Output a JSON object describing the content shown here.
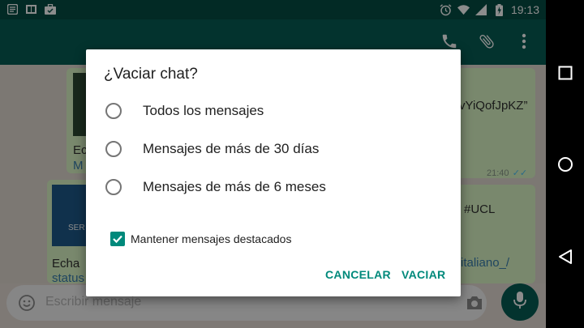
{
  "status_bar": {
    "time": "19:13",
    "icons": [
      "notification-icon",
      "book-icon",
      "briefcase-icon",
      "alarm-icon",
      "wifi-icon",
      "signal-icon",
      "battery-charging-icon"
    ]
  },
  "toolbar": {
    "icons": [
      "phone-icon",
      "attach-icon",
      "more-vert-icon"
    ]
  },
  "chat": {
    "messages": [
      {
        "text_partial": "Ec",
        "link_partial": "M"
      },
      {
        "text_partial": "vYiQofJpKZ”",
        "time": "21:40"
      },
      {
        "text_partial": "Echa",
        "link_partial": "status"
      },
      {
        "text_partial": "#UCL",
        "link_partial": "italiano_/"
      }
    ],
    "thumb_partial": "SER"
  },
  "input": {
    "placeholder": "Escribir mensaje"
  },
  "dialog": {
    "title": "¿Vaciar chat?",
    "options": [
      {
        "label": "Todos los mensajes",
        "selected": false
      },
      {
        "label": "Mensajes de más de 30 días",
        "selected": false
      },
      {
        "label": "Mensajes de más de 6 meses",
        "selected": false
      }
    ],
    "checkbox": {
      "label": "Mantener mensajes destacados",
      "checked": true
    },
    "cancel_label": "CANCELAR",
    "confirm_label": "VACIAR"
  },
  "colors": {
    "accent": "#00897b",
    "toolbar": "#075e54",
    "statusbar": "#054d44",
    "bubble_out": "#dcf8c6"
  },
  "navbar": {
    "icons": [
      "overview-square-icon",
      "home-circle-icon",
      "back-triangle-icon"
    ]
  }
}
